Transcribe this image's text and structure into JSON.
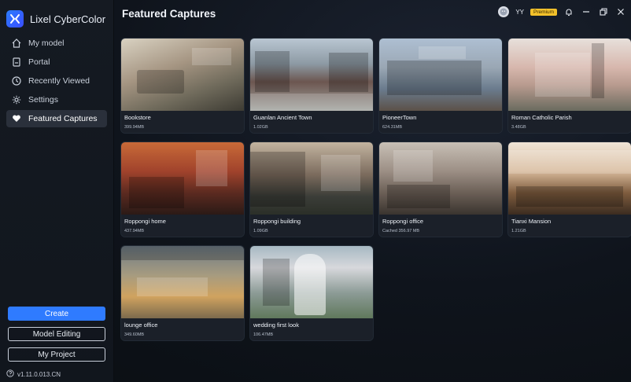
{
  "app": {
    "name": "Lixel CyberColor",
    "page_title": "Featured Captures",
    "user_name": "YY",
    "premium_badge": "Premium",
    "version": "v1.11.0.013.CN"
  },
  "sidebar": {
    "items": [
      {
        "label": "My model",
        "icon": "home-icon"
      },
      {
        "label": "Portal",
        "icon": "portal-icon"
      },
      {
        "label": "Recently Viewed",
        "icon": "clock-icon"
      },
      {
        "label": "Settings",
        "icon": "gear-icon"
      },
      {
        "label": "Featured Captures",
        "icon": "heart-icon",
        "active": true
      }
    ],
    "buttons": {
      "create": "Create",
      "model_editing": "Model Editing",
      "my_project": "My Project"
    }
  },
  "captures": [
    {
      "title": "Bookstore",
      "sub": "399.94MB",
      "theme": "bookstore"
    },
    {
      "title": "Guanlan Ancient Town",
      "sub": "1.02GB",
      "theme": "guanlan"
    },
    {
      "title": "PioneerTown",
      "sub": "624.31MB",
      "theme": "pioneer"
    },
    {
      "title": "Roman Catholic Parish",
      "sub": "3.48GB",
      "theme": "roman"
    },
    {
      "title": "Roppongi home",
      "sub": "437.94MB",
      "theme": "roppongi-home"
    },
    {
      "title": "Roppongi building",
      "sub": "1.09GB",
      "theme": "roppongi-building"
    },
    {
      "title": "Roppongi office",
      "sub": "Cached 356.97 MB",
      "theme": "roppongi-office"
    },
    {
      "title": "Tianxi Mansion",
      "sub": "1.21GB",
      "theme": "tianxi"
    },
    {
      "title": "lounge office",
      "sub": "349.60MB",
      "theme": "lounge"
    },
    {
      "title": "wedding first look",
      "sub": "106.47MB",
      "theme": "wedding"
    }
  ],
  "colors": {
    "accent": "#2f7bff",
    "premium": "#f3c12b"
  }
}
